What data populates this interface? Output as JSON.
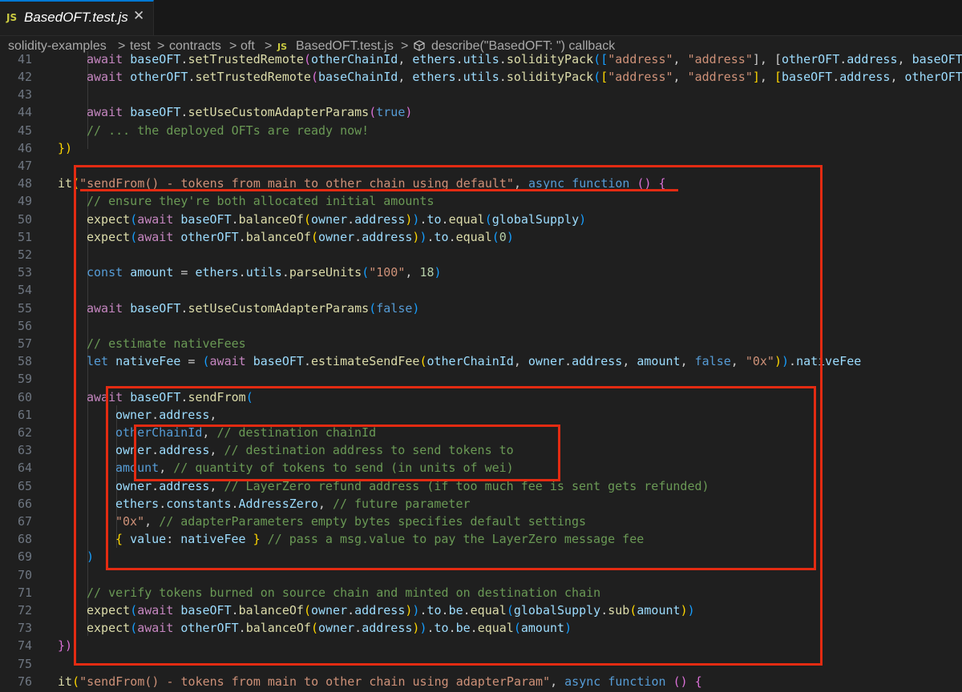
{
  "tab": {
    "badge": "JS",
    "title": "BasedOFT.test.js",
    "close": "✕"
  },
  "breadcrumb": [
    "solidity-examples",
    "test",
    "contracts",
    "oft",
    "BasedOFT.test.js",
    "describe(\"BasedOFT: \") callback"
  ],
  "breadcrumb_separator": ">",
  "colors": {
    "highlight": "#e32b12",
    "keyword": "#c586c0",
    "function": "#dcdcaa",
    "variable": "#9cdcfe",
    "string": "#ce9178",
    "comment": "#6a9955",
    "number": "#b5cea8",
    "constant": "#569cd6"
  },
  "editor": {
    "line_numbers": [
      "41",
      "42",
      "43",
      "44",
      "45",
      "46",
      "47",
      "48",
      "49",
      "50",
      "51",
      "52",
      "53",
      "54",
      "55",
      "56",
      "57",
      "58",
      "59",
      "60",
      "61",
      "62",
      "63",
      "64",
      "65",
      "66",
      "67",
      "68",
      "69",
      "70",
      "71",
      "72",
      "73",
      "74",
      "75",
      "76"
    ],
    "lines": [
      {
        "indent": 1,
        "tokens": [
          [
            "await ",
            "k"
          ],
          [
            "baseOFT",
            "v"
          ],
          [
            ".",
            "t"
          ],
          [
            "setTrustedRemote",
            "f"
          ],
          [
            "(",
            "p2"
          ],
          [
            "otherChainId",
            "v"
          ],
          [
            ", ",
            "t"
          ],
          [
            "ethers",
            "v"
          ],
          [
            ".",
            "t"
          ],
          [
            "utils",
            "v"
          ],
          [
            ".",
            "t"
          ],
          [
            "solidityPack",
            "f"
          ],
          [
            "([",
            "p3"
          ],
          [
            "\"address\"",
            "s"
          ],
          [
            ", ",
            "t"
          ],
          [
            "\"address\"",
            "s"
          ],
          [
            "], [",
            "t"
          ],
          [
            "otherOFT",
            "v"
          ],
          [
            ".",
            "t"
          ],
          [
            "address",
            "v"
          ],
          [
            ", ",
            "t"
          ],
          [
            "baseOFT",
            "v"
          ]
        ]
      },
      {
        "indent": 1,
        "tokens": [
          [
            "await ",
            "k"
          ],
          [
            "otherOFT",
            "v"
          ],
          [
            ".",
            "t"
          ],
          [
            "setTrustedRemote",
            "f"
          ],
          [
            "(",
            "p2"
          ],
          [
            "baseChainId",
            "v"
          ],
          [
            ", ",
            "t"
          ],
          [
            "ethers",
            "v"
          ],
          [
            ".",
            "t"
          ],
          [
            "utils",
            "v"
          ],
          [
            ".",
            "t"
          ],
          [
            "solidityPack",
            "f"
          ],
          [
            "(",
            "p3"
          ],
          [
            "[",
            "p1"
          ],
          [
            "\"address\"",
            "s"
          ],
          [
            ", ",
            "t"
          ],
          [
            "\"address\"",
            "s"
          ],
          [
            "]",
            "p1"
          ],
          [
            ", ",
            "t"
          ],
          [
            "[",
            "p1"
          ],
          [
            "baseOFT",
            "v"
          ],
          [
            ".",
            "t"
          ],
          [
            "address",
            "v"
          ],
          [
            ", ",
            "t"
          ],
          [
            "otherOFT",
            "v"
          ]
        ]
      },
      {
        "indent": 0,
        "tokens": []
      },
      {
        "indent": 1,
        "tokens": [
          [
            "await ",
            "k"
          ],
          [
            "baseOFT",
            "v"
          ],
          [
            ".",
            "t"
          ],
          [
            "setUseCustomAdapterParams",
            "f"
          ],
          [
            "(",
            "p2"
          ],
          [
            "true",
            "b"
          ],
          [
            ")",
            "p2"
          ]
        ]
      },
      {
        "indent": 1,
        "tokens": [
          [
            "// ... the deployed OFTs are ready now!",
            "c"
          ]
        ]
      },
      {
        "indent": 0,
        "tokens": [
          [
            "})",
            "p1"
          ]
        ]
      },
      {
        "indent": 0,
        "tokens": []
      },
      {
        "indent": 0,
        "tokens": [
          [
            "it",
            "f"
          ],
          [
            "(",
            "p1"
          ],
          [
            "\"sendFrom() - tokens from main to other chain using default\"",
            "s"
          ],
          [
            ", ",
            "t"
          ],
          [
            "async ",
            "b"
          ],
          [
            "function ",
            "b"
          ],
          [
            "() ",
            "p2"
          ],
          [
            "{",
            "p2"
          ]
        ]
      },
      {
        "indent": 1,
        "tokens": [
          [
            "// ensure they're both allocated initial amounts",
            "c"
          ]
        ]
      },
      {
        "indent": 1,
        "tokens": [
          [
            "expect",
            "f"
          ],
          [
            "(",
            "p3"
          ],
          [
            "await ",
            "k"
          ],
          [
            "baseOFT",
            "v"
          ],
          [
            ".",
            "t"
          ],
          [
            "balanceOf",
            "f"
          ],
          [
            "(",
            "p1"
          ],
          [
            "owner",
            "v"
          ],
          [
            ".",
            "t"
          ],
          [
            "address",
            "v"
          ],
          [
            ")",
            "p1"
          ],
          [
            ")",
            "p3"
          ],
          [
            ".",
            "t"
          ],
          [
            "to",
            "v"
          ],
          [
            ".",
            "t"
          ],
          [
            "equal",
            "f"
          ],
          [
            "(",
            "p3"
          ],
          [
            "globalSupply",
            "v"
          ],
          [
            ")",
            "p3"
          ]
        ]
      },
      {
        "indent": 1,
        "tokens": [
          [
            "expect",
            "f"
          ],
          [
            "(",
            "p3"
          ],
          [
            "await ",
            "k"
          ],
          [
            "otherOFT",
            "v"
          ],
          [
            ".",
            "t"
          ],
          [
            "balanceOf",
            "f"
          ],
          [
            "(",
            "p1"
          ],
          [
            "owner",
            "v"
          ],
          [
            ".",
            "t"
          ],
          [
            "address",
            "v"
          ],
          [
            ")",
            "p1"
          ],
          [
            ")",
            "p3"
          ],
          [
            ".",
            "t"
          ],
          [
            "to",
            "v"
          ],
          [
            ".",
            "t"
          ],
          [
            "equal",
            "f"
          ],
          [
            "(",
            "p3"
          ],
          [
            "0",
            "n"
          ],
          [
            ")",
            "p3"
          ]
        ]
      },
      {
        "indent": 0,
        "tokens": []
      },
      {
        "indent": 1,
        "tokens": [
          [
            "const ",
            "b"
          ],
          [
            "amount",
            "v"
          ],
          [
            " = ",
            "t"
          ],
          [
            "ethers",
            "v"
          ],
          [
            ".",
            "t"
          ],
          [
            "utils",
            "v"
          ],
          [
            ".",
            "t"
          ],
          [
            "parseUnits",
            "f"
          ],
          [
            "(",
            "p3"
          ],
          [
            "\"100\"",
            "s"
          ],
          [
            ", ",
            "t"
          ],
          [
            "18",
            "n"
          ],
          [
            ")",
            "p3"
          ]
        ]
      },
      {
        "indent": 0,
        "tokens": []
      },
      {
        "indent": 1,
        "tokens": [
          [
            "await ",
            "k"
          ],
          [
            "baseOFT",
            "v"
          ],
          [
            ".",
            "t"
          ],
          [
            "setUseCustomAdapterParams",
            "f"
          ],
          [
            "(",
            "p3"
          ],
          [
            "false",
            "b"
          ],
          [
            ")",
            "p3"
          ]
        ]
      },
      {
        "indent": 0,
        "tokens": []
      },
      {
        "indent": 1,
        "tokens": [
          [
            "// estimate nativeFees",
            "c"
          ]
        ]
      },
      {
        "indent": 1,
        "tokens": [
          [
            "let ",
            "b"
          ],
          [
            "nativeFee",
            "v"
          ],
          [
            " = ",
            "t"
          ],
          [
            "(",
            "p3"
          ],
          [
            "await ",
            "k"
          ],
          [
            "baseOFT",
            "v"
          ],
          [
            ".",
            "t"
          ],
          [
            "estimateSendFee",
            "f"
          ],
          [
            "(",
            "p1"
          ],
          [
            "otherChainId",
            "v"
          ],
          [
            ", ",
            "t"
          ],
          [
            "owner",
            "v"
          ],
          [
            ".",
            "t"
          ],
          [
            "address",
            "v"
          ],
          [
            ", ",
            "t"
          ],
          [
            "amount",
            "v"
          ],
          [
            ", ",
            "t"
          ],
          [
            "false",
            "b"
          ],
          [
            ", ",
            "t"
          ],
          [
            "\"0x\"",
            "s"
          ],
          [
            ")",
            "p1"
          ],
          [
            ")",
            "p3"
          ],
          [
            ".",
            "t"
          ],
          [
            "nativeFee",
            "v"
          ]
        ]
      },
      {
        "indent": 0,
        "tokens": []
      },
      {
        "indent": 1,
        "tokens": [
          [
            "await ",
            "k"
          ],
          [
            "baseOFT",
            "v"
          ],
          [
            ".",
            "t"
          ],
          [
            "sendFrom",
            "f"
          ],
          [
            "(",
            "p3"
          ]
        ]
      },
      {
        "indent": 2,
        "tokens": [
          [
            "owner",
            "v"
          ],
          [
            ".",
            "t"
          ],
          [
            "address",
            "v"
          ],
          [
            ",",
            "t"
          ]
        ]
      },
      {
        "indent": 2,
        "tokens": [
          [
            "otherChainId",
            "b"
          ],
          [
            ", ",
            "t"
          ],
          [
            "// destination chainId",
            "c"
          ]
        ]
      },
      {
        "indent": 2,
        "tokens": [
          [
            "owner",
            "v"
          ],
          [
            ".",
            "t"
          ],
          [
            "address",
            "v"
          ],
          [
            ", ",
            "t"
          ],
          [
            "// destination address to send tokens to",
            "c"
          ]
        ]
      },
      {
        "indent": 2,
        "tokens": [
          [
            "amount",
            "b"
          ],
          [
            ", ",
            "t"
          ],
          [
            "// quantity of tokens to send (in units of wei)",
            "c"
          ]
        ]
      },
      {
        "indent": 2,
        "tokens": [
          [
            "owner",
            "v"
          ],
          [
            ".",
            "t"
          ],
          [
            "address",
            "v"
          ],
          [
            ", ",
            "t"
          ],
          [
            "// LayerZero refund address (if too much fee is sent gets refunded)",
            "c"
          ]
        ]
      },
      {
        "indent": 2,
        "tokens": [
          [
            "ethers",
            "v"
          ],
          [
            ".",
            "t"
          ],
          [
            "constants",
            "v"
          ],
          [
            ".",
            "t"
          ],
          [
            "AddressZero",
            "v"
          ],
          [
            ", ",
            "t"
          ],
          [
            "// future parameter",
            "c"
          ]
        ]
      },
      {
        "indent": 2,
        "tokens": [
          [
            "\"0x\"",
            "s"
          ],
          [
            ", ",
            "t"
          ],
          [
            "// adapterParameters empty bytes specifies default settings",
            "c"
          ]
        ]
      },
      {
        "indent": 2,
        "tokens": [
          [
            "{ ",
            "p1"
          ],
          [
            "value",
            "v"
          ],
          [
            ": ",
            "t"
          ],
          [
            "nativeFee",
            "v"
          ],
          [
            " }",
            "p1"
          ],
          [
            " ",
            "t"
          ],
          [
            "// pass a msg.value to pay the LayerZero message fee",
            "c"
          ]
        ]
      },
      {
        "indent": 1,
        "tokens": [
          [
            ")",
            "p3"
          ]
        ]
      },
      {
        "indent": 0,
        "tokens": []
      },
      {
        "indent": 1,
        "tokens": [
          [
            "// verify tokens burned on source chain and minted on destination chain",
            "c"
          ]
        ]
      },
      {
        "indent": 1,
        "tokens": [
          [
            "expect",
            "f"
          ],
          [
            "(",
            "p3"
          ],
          [
            "await ",
            "k"
          ],
          [
            "baseOFT",
            "v"
          ],
          [
            ".",
            "t"
          ],
          [
            "balanceOf",
            "f"
          ],
          [
            "(",
            "p1"
          ],
          [
            "owner",
            "v"
          ],
          [
            ".",
            "t"
          ],
          [
            "address",
            "v"
          ],
          [
            ")",
            "p1"
          ],
          [
            ")",
            "p3"
          ],
          [
            ".",
            "t"
          ],
          [
            "to",
            "v"
          ],
          [
            ".",
            "t"
          ],
          [
            "be",
            "v"
          ],
          [
            ".",
            "t"
          ],
          [
            "equal",
            "f"
          ],
          [
            "(",
            "p3"
          ],
          [
            "globalSupply",
            "v"
          ],
          [
            ".",
            "t"
          ],
          [
            "sub",
            "f"
          ],
          [
            "(",
            "p1"
          ],
          [
            "amount",
            "v"
          ],
          [
            ")",
            "p1"
          ],
          [
            ")",
            "p3"
          ]
        ]
      },
      {
        "indent": 1,
        "tokens": [
          [
            "expect",
            "f"
          ],
          [
            "(",
            "p3"
          ],
          [
            "await ",
            "k"
          ],
          [
            "otherOFT",
            "v"
          ],
          [
            ".",
            "t"
          ],
          [
            "balanceOf",
            "f"
          ],
          [
            "(",
            "p1"
          ],
          [
            "owner",
            "v"
          ],
          [
            ".",
            "t"
          ],
          [
            "address",
            "v"
          ],
          [
            ")",
            "p1"
          ],
          [
            ")",
            "p3"
          ],
          [
            ".",
            "t"
          ],
          [
            "to",
            "v"
          ],
          [
            ".",
            "t"
          ],
          [
            "be",
            "v"
          ],
          [
            ".",
            "t"
          ],
          [
            "equal",
            "f"
          ],
          [
            "(",
            "p3"
          ],
          [
            "amount",
            "v"
          ],
          [
            ")",
            "p3"
          ]
        ]
      },
      {
        "indent": 0,
        "tokens": [
          [
            "})",
            "p2"
          ]
        ]
      },
      {
        "indent": 0,
        "tokens": []
      },
      {
        "indent": 0,
        "tokens": [
          [
            "it",
            "f"
          ],
          [
            "(",
            "p1"
          ],
          [
            "\"sendFrom() - tokens from main to other chain using adapterParam\"",
            "s"
          ],
          [
            ", ",
            "t"
          ],
          [
            "async ",
            "b"
          ],
          [
            "function ",
            "b"
          ],
          [
            "() ",
            "p2"
          ],
          [
            "{",
            "p2"
          ]
        ]
      }
    ]
  }
}
